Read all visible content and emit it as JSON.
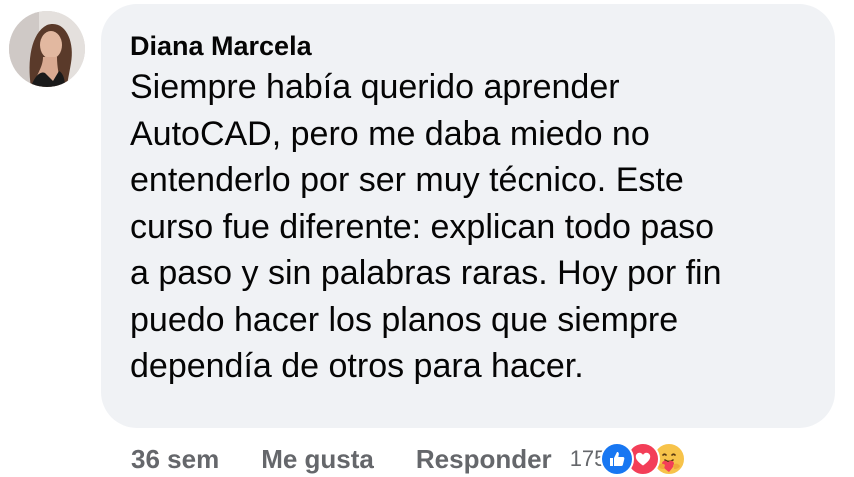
{
  "comment": {
    "author": "Diana Marcela",
    "text": "Siempre había querido aprender\nAutoCAD, pero me daba miedo no\nentenderlo por ser muy técnico. Este\ncurso fue diferente: explican todo paso\na paso y sin palabras raras. Hoy por fin\npuedo hacer los planos que siempre\ndependía de otros para hacer."
  },
  "actions": {
    "timestamp": "36 sem",
    "like_label": "Me gusta",
    "reply_label": "Responder"
  },
  "reactions": {
    "count": "175",
    "icons": [
      "like-icon",
      "love-icon",
      "care-icon"
    ],
    "colors": {
      "like": "#1877f2",
      "love": "#f33e58",
      "care": "#f7c34a"
    }
  },
  "colors": {
    "bubble": "#f0f2f5",
    "text": "#050505",
    "secondary_text": "#65676b"
  }
}
